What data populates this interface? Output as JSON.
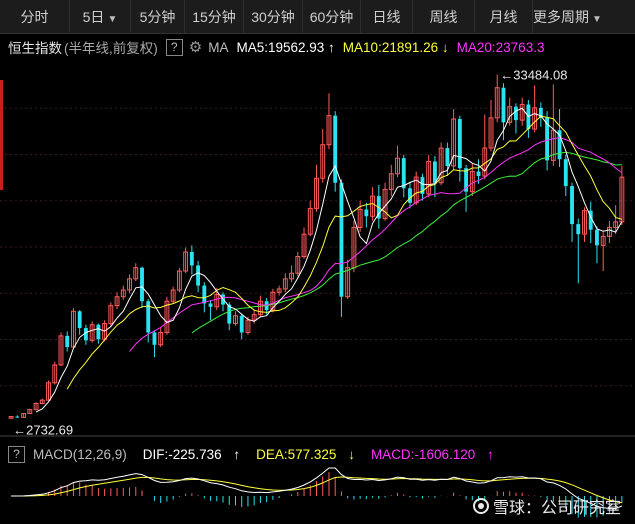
{
  "tabs": [
    {
      "label": "分时",
      "w": 0
    },
    {
      "label": "5日",
      "dropdown": true
    },
    {
      "label": "5分钟"
    },
    {
      "label": "15分钟"
    },
    {
      "label": "30分钟"
    },
    {
      "label": "60分钟"
    },
    {
      "label": "日线"
    },
    {
      "label": "周线"
    },
    {
      "label": "月线"
    },
    {
      "label": "更多周期",
      "dropdown": true
    }
  ],
  "info": {
    "title": "恒生指数",
    "subtitle": "(半年线,前复权)",
    "help": "?",
    "ma_label": "MA",
    "ma5": "MA5:19562.93",
    "ma10": "MA10:21891.26",
    "ma20": "MA20:23763.3",
    "arrow_up": "↑",
    "arrow_down": "↓"
  },
  "chart_data": {
    "type": "candlestick",
    "high_label": "33484.08",
    "low_label": "2732.69",
    "colors": {
      "up": "#ff5a5a",
      "down": "#29e3f0",
      "ma5": "#ffffff",
      "ma10": "#ffff3b",
      "ma20": "#ff33ff",
      "ma30": "#3cf03c"
    },
    "candles": [
      [
        2730,
        2880,
        2720,
        2940
      ],
      [
        2880,
        2810,
        2760,
        2990
      ],
      [
        2810,
        3150,
        2790,
        3210
      ],
      [
        3150,
        3500,
        3120,
        3580
      ],
      [
        3500,
        4050,
        3460,
        4150
      ],
      [
        4050,
        4350,
        3980,
        4500
      ],
      [
        4350,
        5900,
        4300,
        6100
      ],
      [
        5900,
        7500,
        5750,
        7800
      ],
      [
        7500,
        10100,
        7400,
        10400
      ],
      [
        10100,
        9100,
        8700,
        10500
      ],
      [
        9100,
        12300,
        9000,
        12600
      ],
      [
        12300,
        10800,
        10200,
        12400
      ],
      [
        10800,
        9700,
        9300,
        11100
      ],
      [
        9700,
        11100,
        9500,
        11400
      ],
      [
        11100,
        9800,
        9400,
        11200
      ],
      [
        9800,
        11200,
        9600,
        11500
      ],
      [
        11200,
        12800,
        11000,
        13100
      ],
      [
        12800,
        13600,
        12500,
        14000
      ],
      [
        13600,
        14200,
        13300,
        14600
      ],
      [
        14200,
        15200,
        13900,
        15600
      ],
      [
        15200,
        16200,
        15000,
        16600
      ],
      [
        16200,
        13200,
        12600,
        16300
      ],
      [
        13200,
        10400,
        9500,
        13400
      ],
      [
        10400,
        9300,
        8200,
        10600
      ],
      [
        9300,
        10400,
        9100,
        10900
      ],
      [
        10400,
        13200,
        10200,
        13600
      ],
      [
        13200,
        14200,
        13000,
        14500
      ],
      [
        14200,
        15900,
        14000,
        16200
      ],
      [
        15900,
        17600,
        15700,
        18000
      ],
      [
        17600,
        16400,
        15600,
        18200
      ],
      [
        16400,
        14600,
        14000,
        16800
      ],
      [
        14600,
        13000,
        12200,
        14900
      ],
      [
        13000,
        12700,
        11500,
        13300
      ],
      [
        12700,
        13800,
        12400,
        14400
      ],
      [
        13800,
        12900,
        12300,
        14000
      ],
      [
        12900,
        11200,
        10600,
        13100
      ],
      [
        11200,
        11900,
        11000,
        12300
      ],
      [
        11900,
        10400,
        9800,
        12100
      ],
      [
        10400,
        11500,
        10200,
        11800
      ],
      [
        11500,
        12000,
        11200,
        12400
      ],
      [
        12000,
        13200,
        11800,
        13700
      ],
      [
        13200,
        12400,
        12000,
        13500
      ],
      [
        12400,
        14000,
        12200,
        14300
      ],
      [
        14000,
        14300,
        13700,
        14600
      ],
      [
        14300,
        15200,
        14000,
        15700
      ],
      [
        15200,
        15700,
        14900,
        16400
      ],
      [
        15700,
        17200,
        15400,
        17600
      ],
      [
        17200,
        19200,
        17000,
        19800
      ],
      [
        19200,
        21500,
        19000,
        22200
      ],
      [
        21500,
        24200,
        21200,
        25400
      ],
      [
        24200,
        27200,
        23800,
        28600
      ],
      [
        27200,
        29800,
        26800,
        31800
      ],
      [
        29800,
        23800,
        23000,
        30200
      ],
      [
        23800,
        13600,
        11800,
        24100
      ],
      [
        13600,
        16200,
        13400,
        16900
      ],
      [
        16200,
        19800,
        15800,
        20400
      ],
      [
        19800,
        21400,
        19400,
        22200
      ],
      [
        21400,
        20800,
        19800,
        22000
      ],
      [
        20800,
        22600,
        20400,
        23400
      ],
      [
        22600,
        20600,
        19700,
        23600
      ],
      [
        20600,
        23200,
        20400,
        23800
      ],
      [
        23200,
        24600,
        22600,
        25400
      ],
      [
        24600,
        26000,
        24300,
        27100
      ],
      [
        26000,
        23300,
        22500,
        26300
      ],
      [
        23300,
        22000,
        21500,
        23900
      ],
      [
        22000,
        24300,
        21800,
        24800
      ],
      [
        24300,
        22800,
        22200,
        24600
      ],
      [
        22800,
        25700,
        22500,
        26300
      ],
      [
        25700,
        23800,
        22500,
        26200
      ],
      [
        23800,
        26900,
        23600,
        27400
      ],
      [
        26900,
        25300,
        24400,
        27400
      ],
      [
        25300,
        29500,
        24900,
        30400
      ],
      [
        29500,
        25100,
        23900,
        29800
      ],
      [
        25100,
        23000,
        21200,
        25400
      ],
      [
        23000,
        24800,
        22600,
        25500
      ],
      [
        24800,
        24400,
        23700,
        25900
      ],
      [
        24400,
        26900,
        24100,
        29900
      ],
      [
        26900,
        29600,
        26600,
        31200
      ],
      [
        29600,
        32300,
        29200,
        33484
      ],
      [
        32300,
        29200,
        27600,
        32700
      ],
      [
        29200,
        30600,
        28900,
        31400
      ],
      [
        30600,
        29400,
        28200,
        30900
      ],
      [
        29400,
        30800,
        28900,
        31400
      ],
      [
        30800,
        28600,
        27800,
        31200
      ],
      [
        28600,
        30500,
        28300,
        32500
      ],
      [
        30500,
        29600,
        28800,
        31000
      ],
      [
        29600,
        25800,
        24900,
        30200
      ],
      [
        25800,
        28500,
        25300,
        32600
      ],
      [
        28500,
        25900,
        25200,
        30400
      ],
      [
        25900,
        23500,
        22600,
        26300
      ],
      [
        23500,
        20100,
        18500,
        23800
      ],
      [
        20100,
        19200,
        14800,
        20600
      ],
      [
        19200,
        21300,
        18500,
        21600
      ],
      [
        21300,
        19600,
        18400,
        22100
      ],
      [
        19600,
        18200,
        16600,
        19900
      ],
      [
        18200,
        19000,
        15900,
        19500
      ],
      [
        19000,
        19800,
        18400,
        20400
      ],
      [
        19800,
        20300,
        19200,
        21800
      ],
      [
        20300,
        24300,
        20000,
        25300
      ]
    ]
  },
  "macd": {
    "help": "?",
    "label": "MACD(12,26,9)",
    "dif": "DIF:-225.736",
    "dea": "DEA:577.325",
    "macd": "MACD:-1606.120",
    "arrow_up": "↑",
    "arrow_down": "↓"
  },
  "watermark": "雪球：公司研究室"
}
